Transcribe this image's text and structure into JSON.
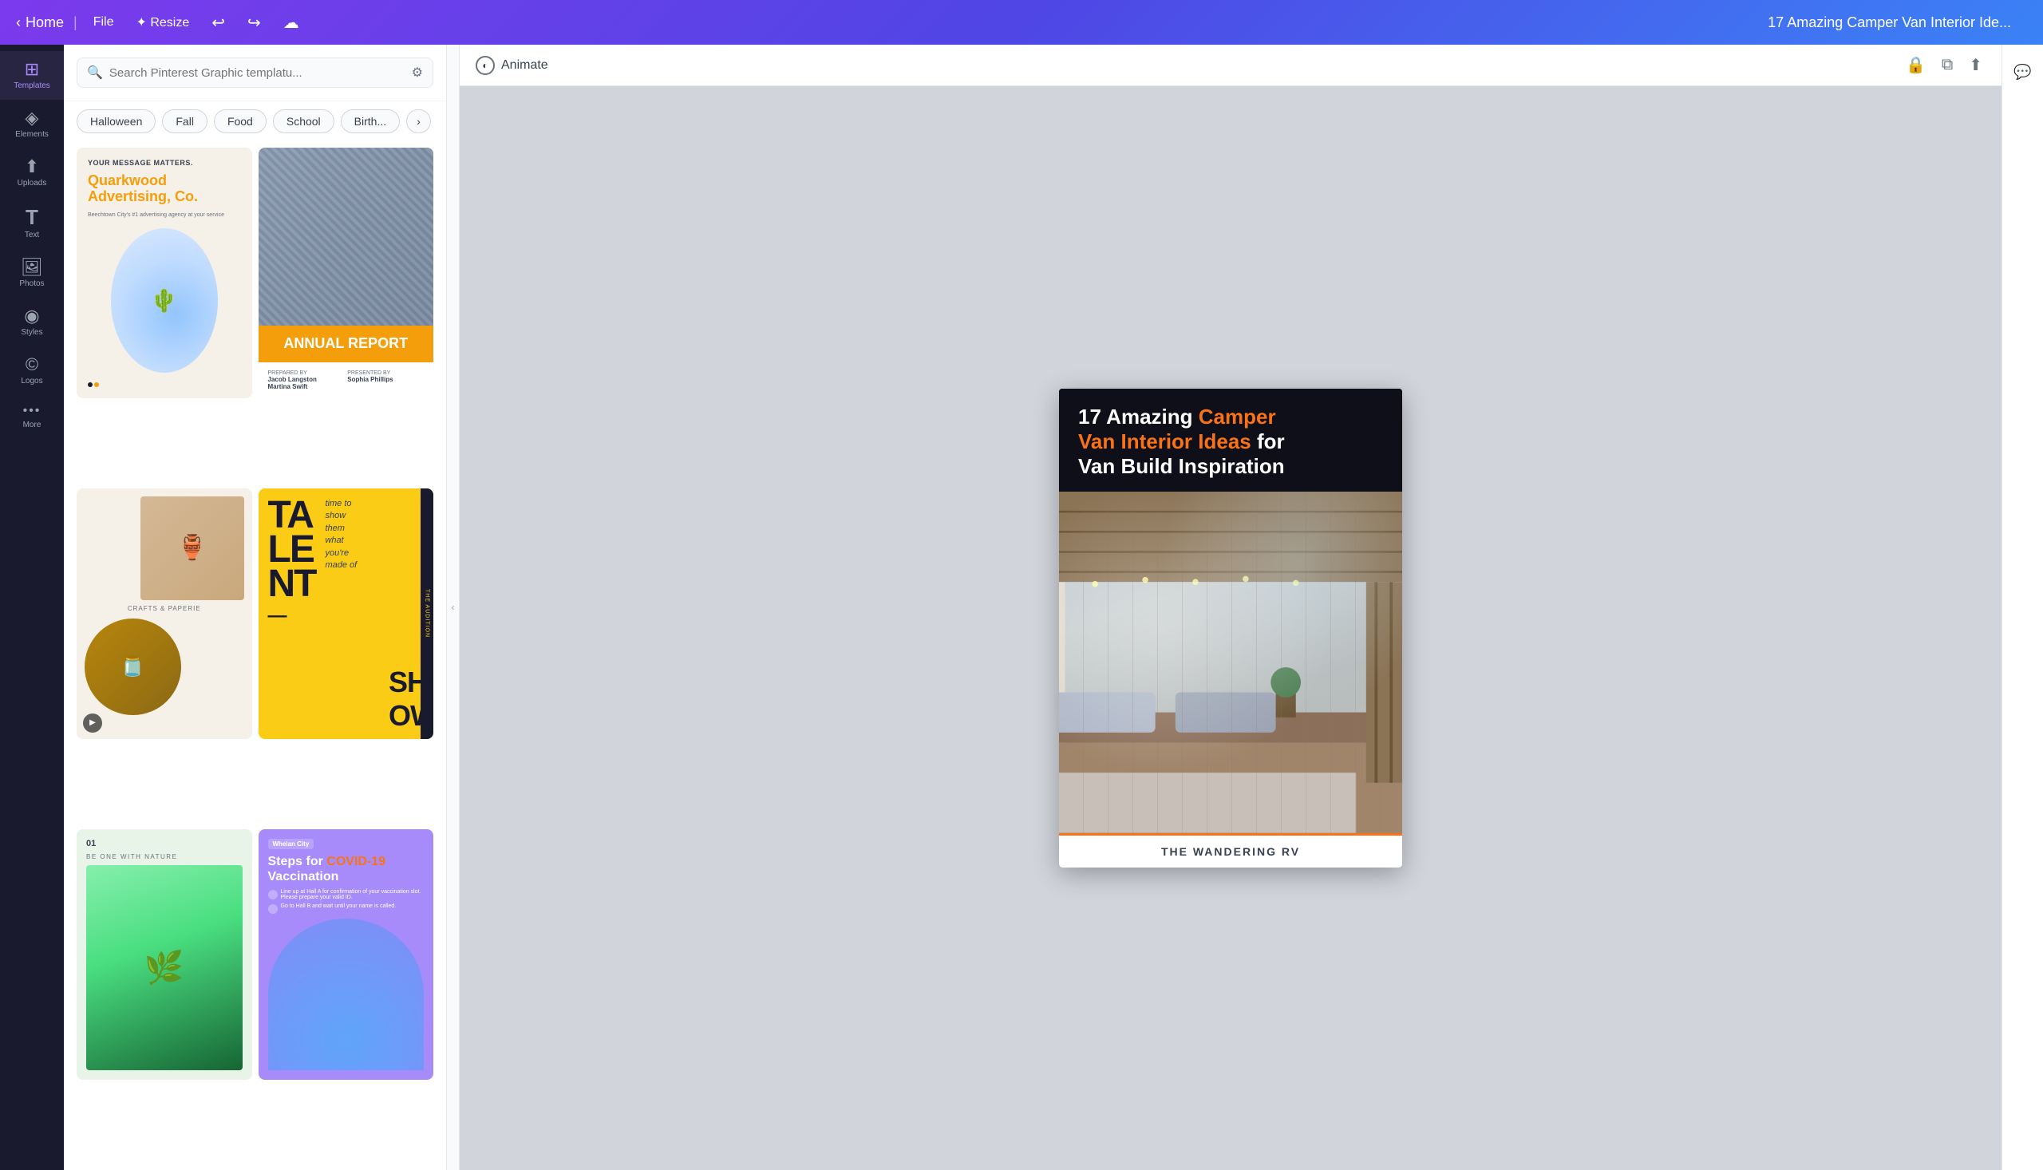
{
  "topbar": {
    "home_label": "Home",
    "file_label": "File",
    "resize_label": "Resize",
    "undo_icon": "↩",
    "redo_icon": "↪",
    "cloud_icon": "☁",
    "title": "17 Amazing Camper Van Interior Ide..."
  },
  "sidebar": {
    "items": [
      {
        "id": "templates",
        "icon": "⊞",
        "label": "Templates",
        "active": true
      },
      {
        "id": "elements",
        "icon": "◈",
        "label": "Elements",
        "active": false
      },
      {
        "id": "uploads",
        "icon": "⬆",
        "label": "Uploads",
        "active": false
      },
      {
        "id": "text",
        "icon": "T",
        "label": "Text",
        "active": false
      },
      {
        "id": "photos",
        "icon": "🖼",
        "label": "Photos",
        "active": false
      },
      {
        "id": "styles",
        "icon": "◉",
        "label": "Styles",
        "active": false
      },
      {
        "id": "logos",
        "icon": "©",
        "label": "Logos",
        "active": false
      },
      {
        "id": "more",
        "icon": "•••",
        "label": "More",
        "active": false
      }
    ]
  },
  "panel": {
    "search_placeholder": "Search Pinterest Graphic templatu...",
    "tags": [
      "Halloween",
      "Fall",
      "Food",
      "School",
      "Birth..."
    ],
    "templates": [
      {
        "id": "quarkwood",
        "type": "quarkwood",
        "title": "Quarkwood Advertising, Co.",
        "subtitle": "YOUR MESSAGE MATTERS.",
        "description": "Beechtown City's #1 advertising agency at your service"
      },
      {
        "id": "annual-report",
        "type": "annual",
        "banner_text": "ANNUAL REPORT",
        "prepared_by": "PREPARED BY",
        "presented_by": "PRESENTED BY",
        "name1": "Jacob Langston",
        "name1_role": "Martina Swift",
        "name2": "Sophia Phillips"
      },
      {
        "id": "crafts",
        "type": "crafts",
        "logo": "CRAFTS & PAPERIE"
      },
      {
        "id": "talent",
        "type": "talent",
        "big_text": "TA\nLE\nNT",
        "italic_text": "time to\nshow\nthem\nwhat\nyou're\nmade of",
        "dash": "—",
        "show_text": "SH\nOW"
      },
      {
        "id": "nature",
        "type": "nature",
        "num": "01",
        "tag": "BE ONE WITH NATURE"
      },
      {
        "id": "covid",
        "type": "covid",
        "logo": "Whelan City",
        "title": "Steps for COVID-19 Vaccination",
        "highlight": "COVID-19",
        "step1": "Line up at Hall A for confirmation of your vaccination slot. Please prepare your valid ID.",
        "step2": "Go to Hall B and wait until your name is called."
      }
    ]
  },
  "canvas": {
    "animate_label": "Animate",
    "title_line1": "17 Amazing ",
    "title_orange": "Camper",
    "title_line2_orange": "Van Interior Ideas",
    "title_line2_white": " for",
    "title_line3": "Van Build Inspiration",
    "footer_text": "THE WANDERING RV"
  }
}
